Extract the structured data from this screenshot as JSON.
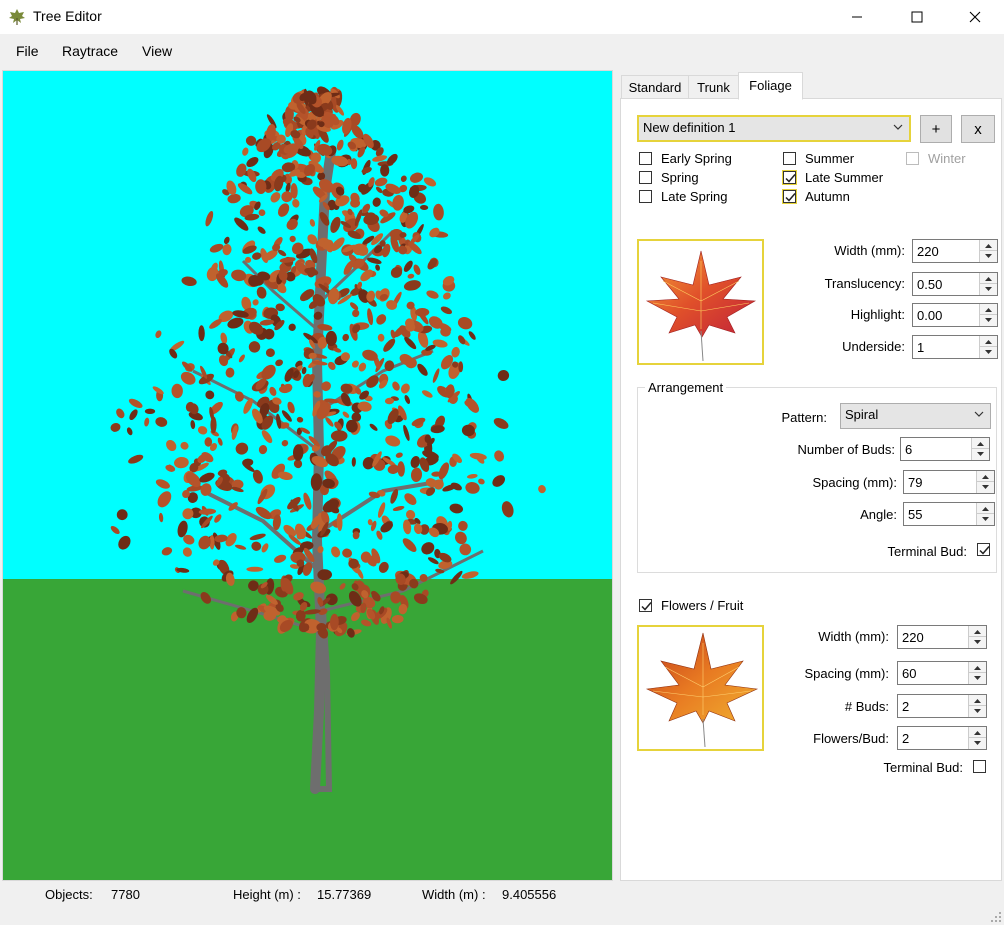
{
  "window": {
    "title": "Tree Editor",
    "icon": "leaf-icon",
    "minimize": "minimize-icon",
    "maximize": "maximize-icon",
    "close": "close-icon"
  },
  "menu": {
    "file": "File",
    "raytrace": "Raytrace",
    "view": "View"
  },
  "viewport": {
    "sky_color": "#00ffff",
    "ground_color": "#38a637",
    "foliage_color": "#a84a25",
    "trunk_color": "#6e6e6e"
  },
  "status": {
    "objects_label": "Objects:",
    "objects_value": "7780",
    "height_label": "Height (m) :",
    "height_value": "15.77369",
    "width_label": "Width (m) :",
    "width_value": "9.405556"
  },
  "tabs": [
    "Standard",
    "Trunk",
    "Foliage"
  ],
  "active_tab": "Foliage",
  "foliage": {
    "definition": "New definition 1",
    "add_label": "+",
    "remove_label": "x",
    "seasons": [
      {
        "label": "Early Spring",
        "checked": false,
        "enabled": true
      },
      {
        "label": "Spring",
        "checked": false,
        "enabled": true
      },
      {
        "label": "Late Spring",
        "checked": false,
        "enabled": true
      },
      {
        "label": "Summer",
        "checked": false,
        "enabled": true
      },
      {
        "label": "Late Summer",
        "checked": true,
        "enabled": true
      },
      {
        "label": "Autumn",
        "checked": true,
        "enabled": true
      },
      {
        "label": "Winter",
        "checked": false,
        "enabled": false
      }
    ],
    "leaf": {
      "width_label": "Width (mm):",
      "width": "220",
      "translucency_label": "Translucency:",
      "translucency": "0.50",
      "highlight_label": "Highlight:",
      "highlight": "0.00",
      "underside_label": "Underside:",
      "underside": "1"
    },
    "arrangement": {
      "title": "Arrangement",
      "pattern_label": "Pattern:",
      "pattern": "Spiral",
      "buds_label": "Number of Buds:",
      "buds": "6",
      "spacing_label": "Spacing (mm):",
      "spacing": "79",
      "angle_label": "Angle:",
      "angle": "55",
      "terminal_label": "Terminal Bud:",
      "terminal_checked": true
    },
    "flowers": {
      "label": "Flowers / Fruit",
      "checked": true,
      "width_label": "Width (mm):",
      "width": "220",
      "spacing_label": "Spacing (mm):",
      "spacing": "60",
      "buds_label": "# Buds:",
      "buds": "2",
      "per_bud_label": "Flowers/Bud:",
      "per_bud": "2",
      "terminal_label": "Terminal Bud:",
      "terminal_checked": false
    }
  }
}
